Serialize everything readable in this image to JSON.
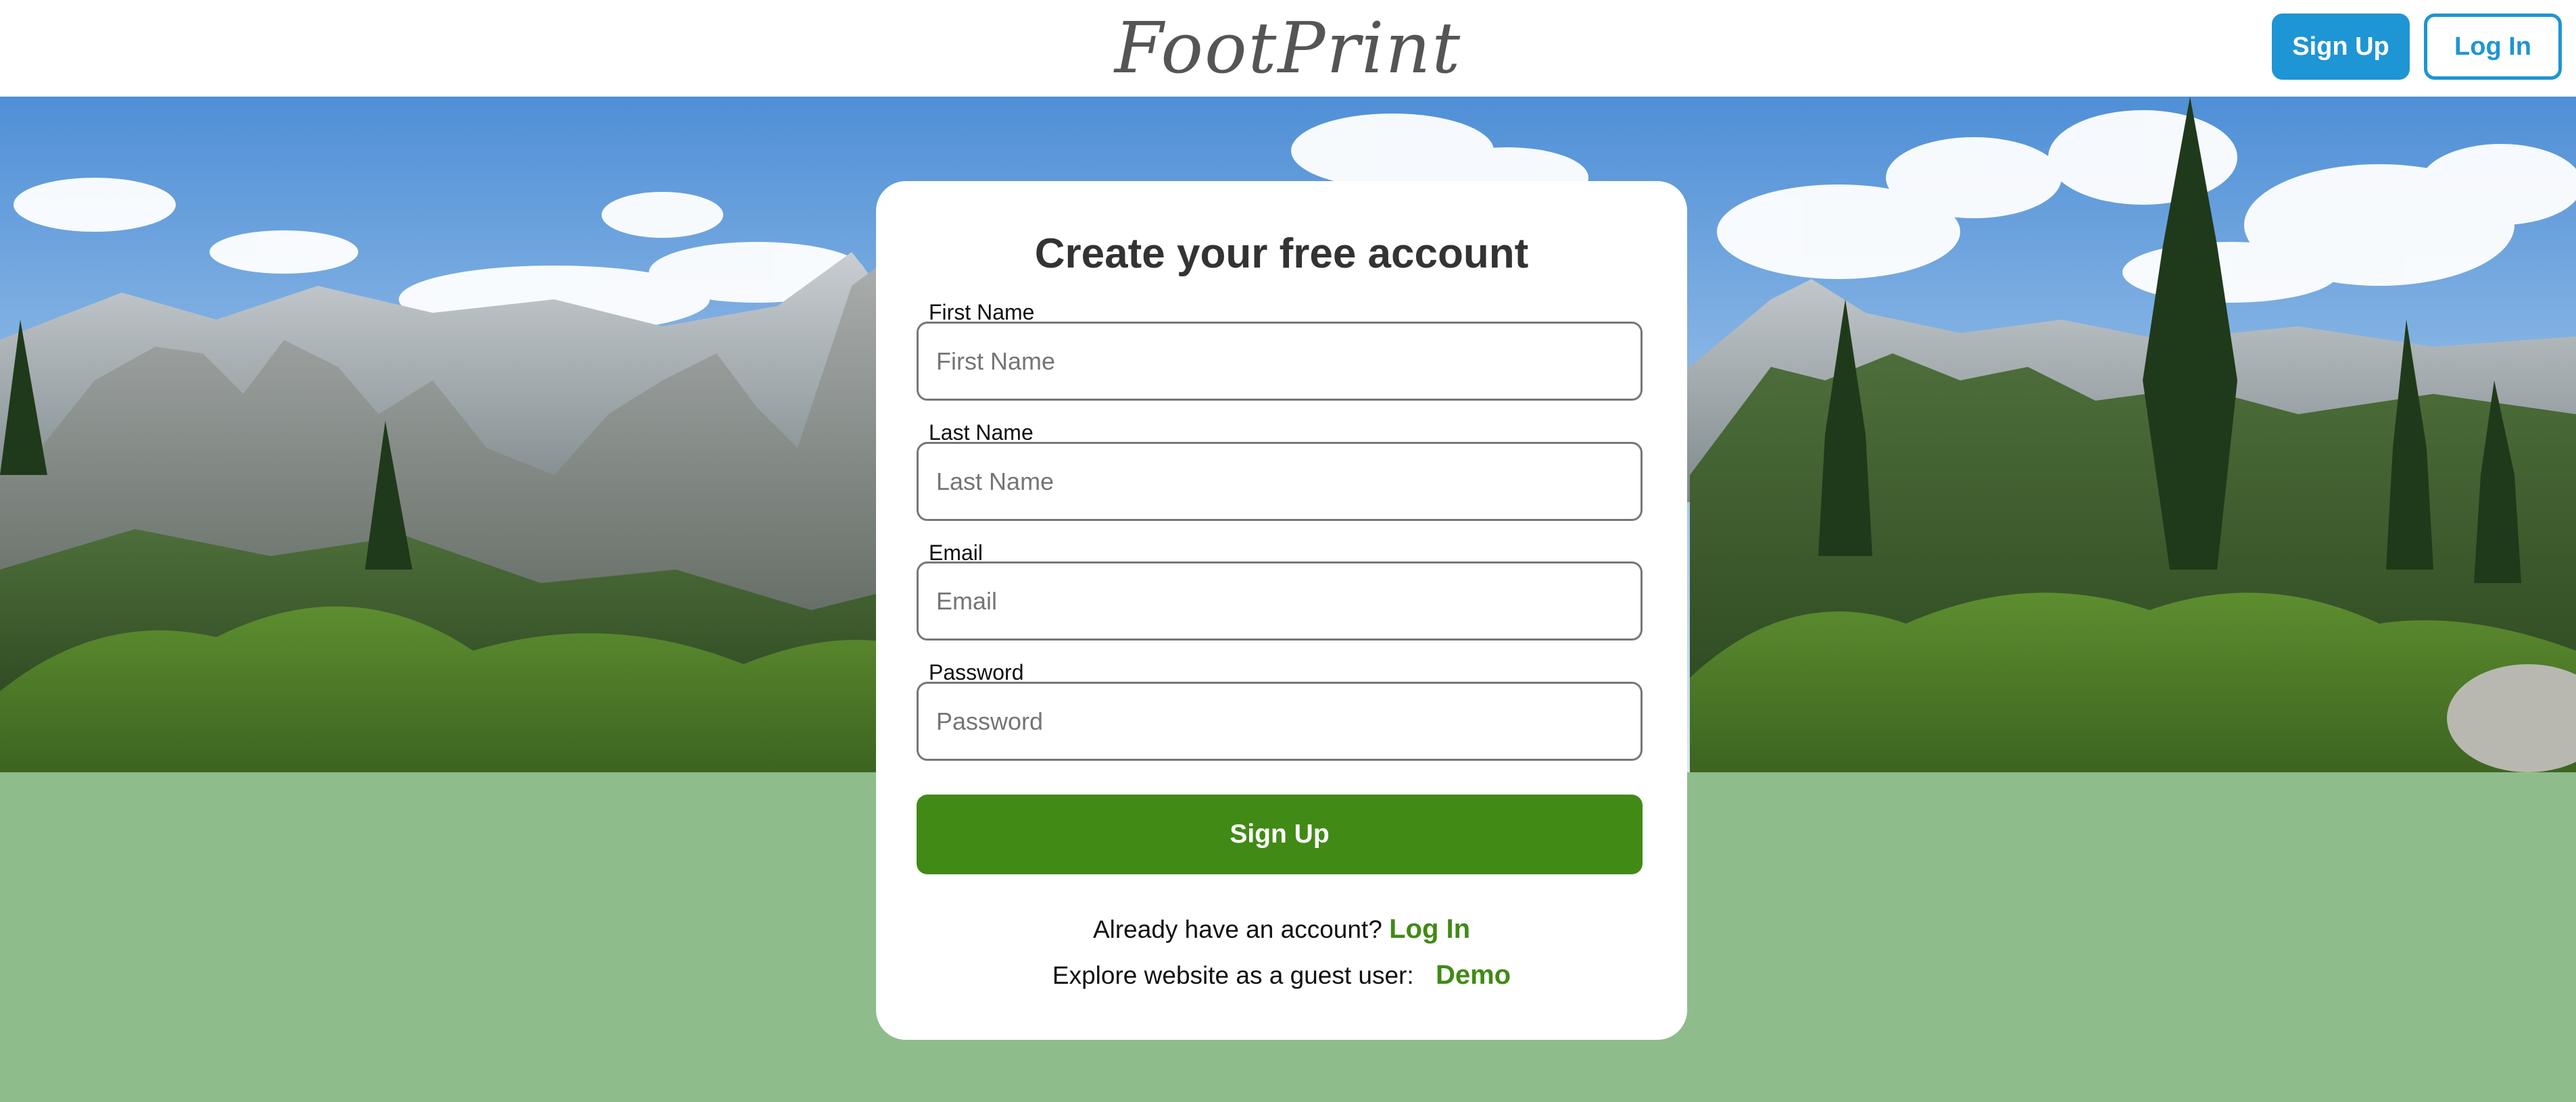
{
  "header": {
    "logo": "FootPrint",
    "signup_label": "Sign Up",
    "login_label": "Log In"
  },
  "form": {
    "title": "Create your free account",
    "fields": [
      {
        "label": "First Name",
        "placeholder": "First Name",
        "value": ""
      },
      {
        "label": "Last Name",
        "placeholder": "Last Name",
        "value": ""
      },
      {
        "label": "Email",
        "placeholder": "Email",
        "value": ""
      },
      {
        "label": "Password",
        "placeholder": "Password",
        "value": ""
      }
    ],
    "submit_label": "Sign Up",
    "have_account_text": "Already have an account?",
    "login_link": "Log In",
    "guest_text": "Explore website as a guest user:",
    "demo_link": "Demo"
  },
  "colors": {
    "header_button": "#1e95d4",
    "primary_green": "#418a16",
    "page_background": "#8fbc8b"
  }
}
